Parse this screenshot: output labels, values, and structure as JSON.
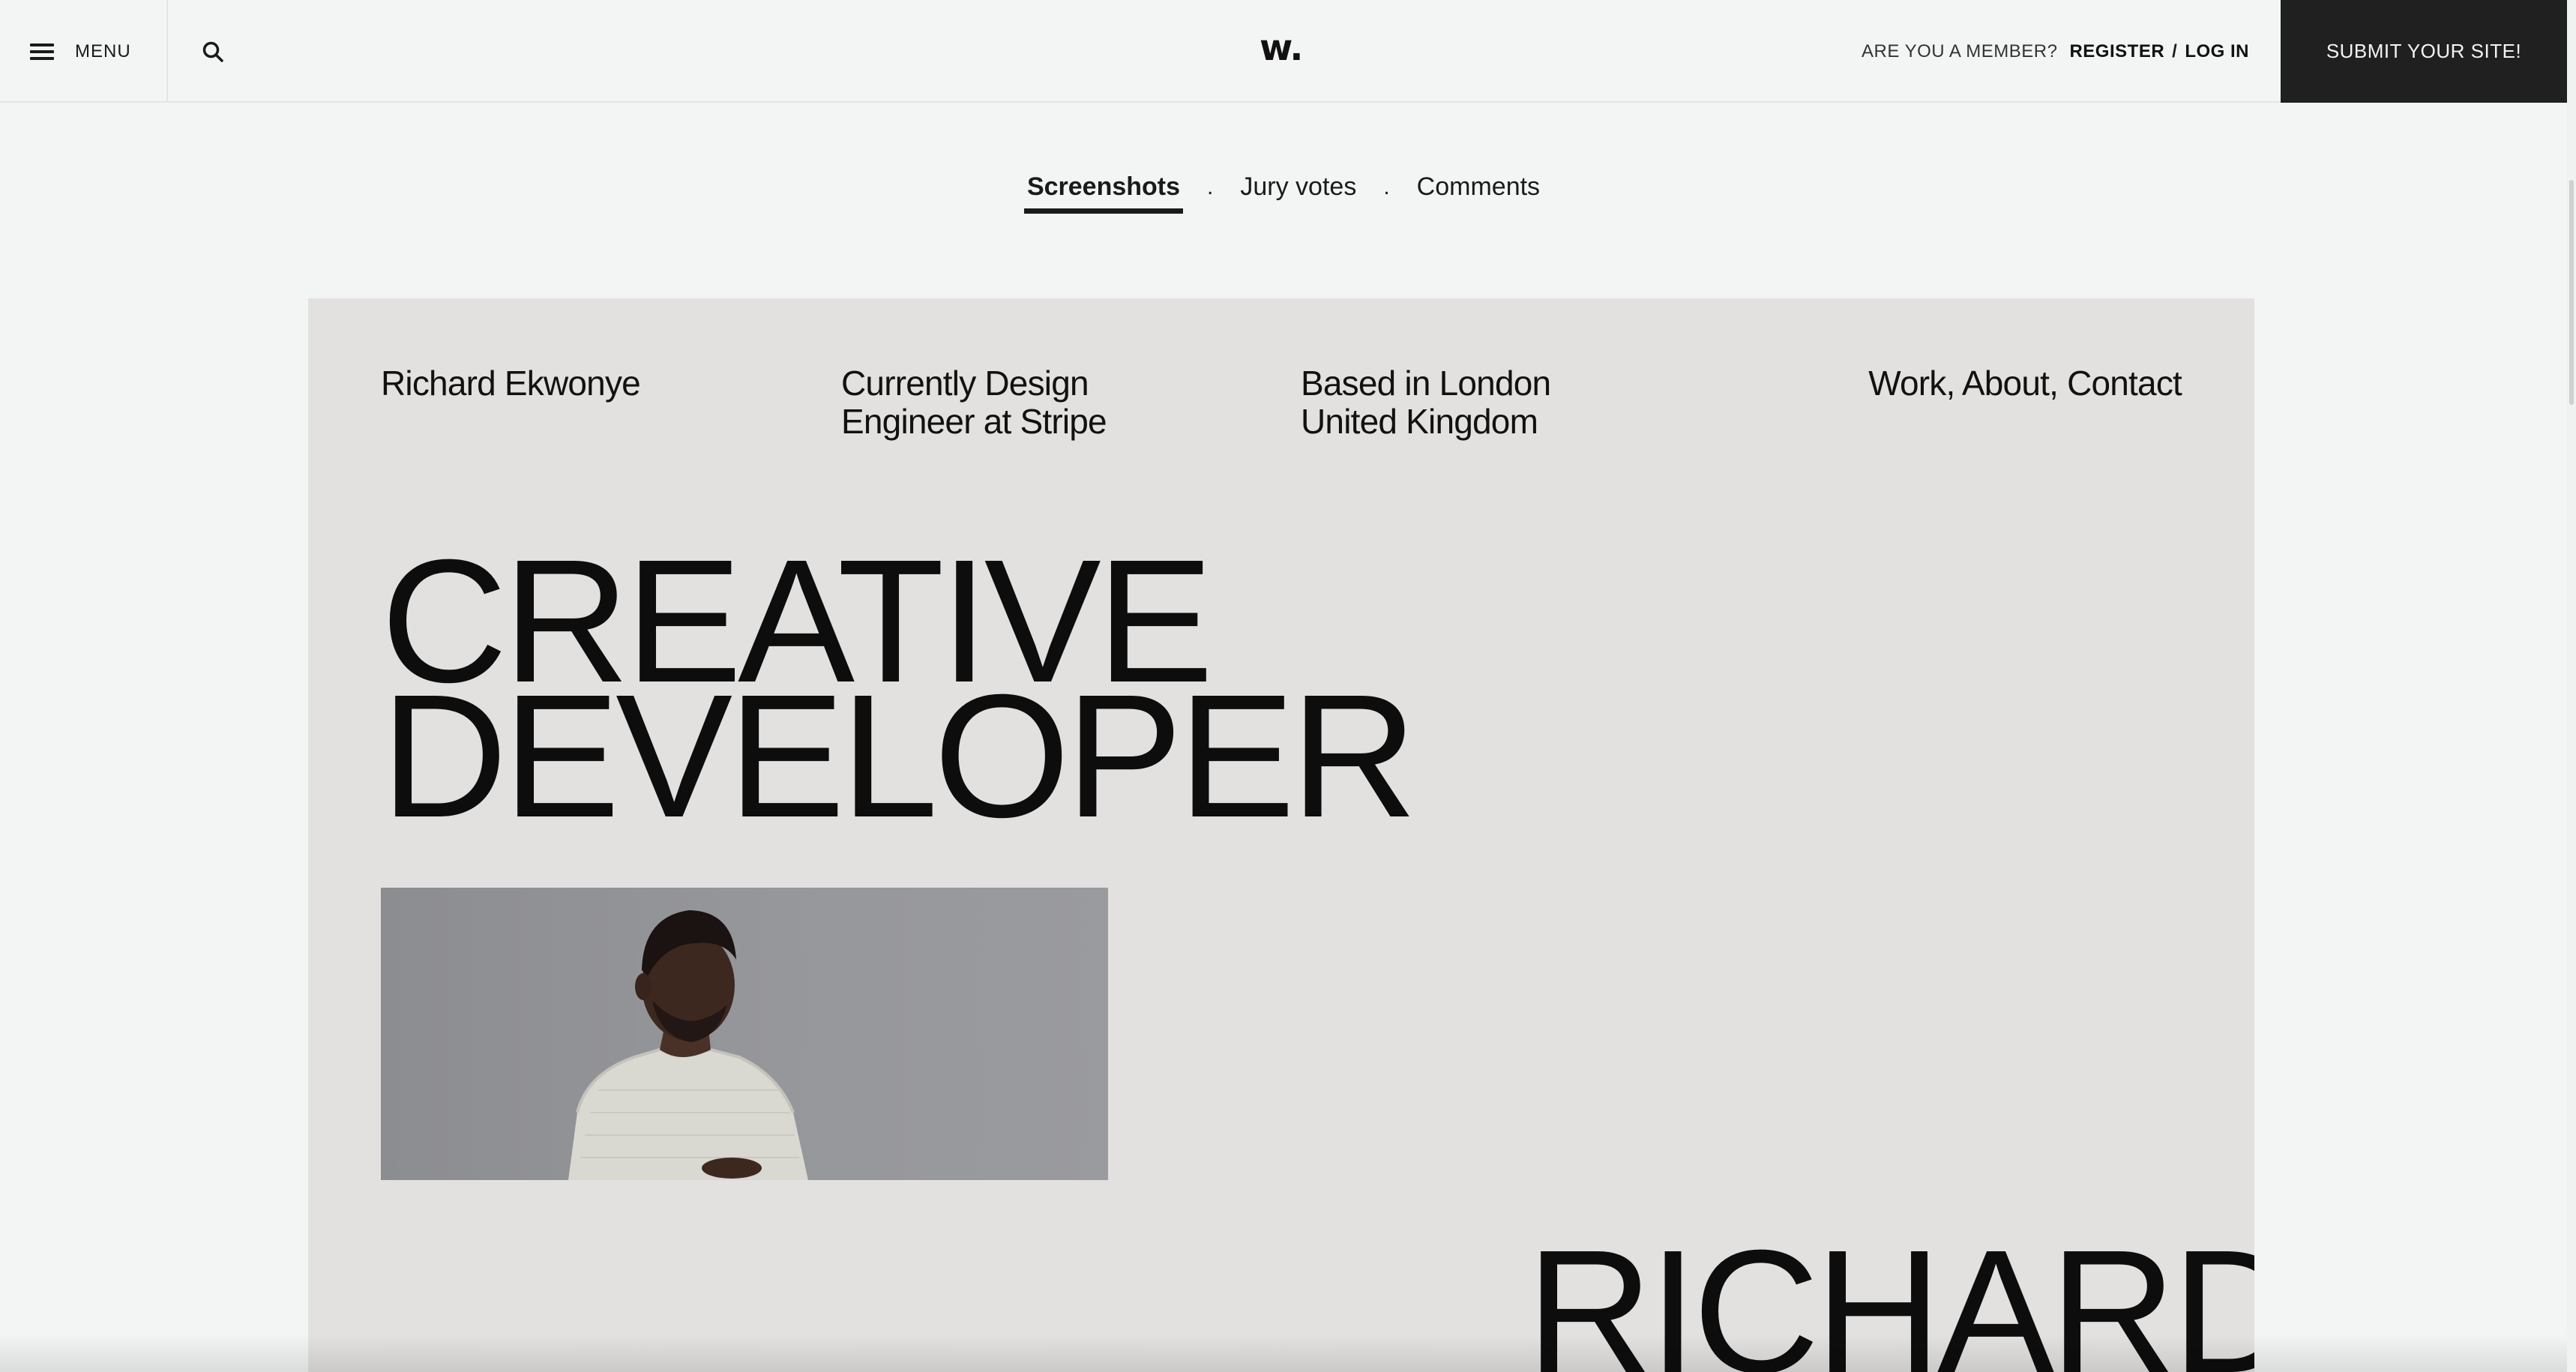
{
  "header": {
    "menu_label": "MENU",
    "logo": "w.",
    "member_question": "ARE YOU A MEMBER?",
    "register_label": "REGISTER",
    "separator": "/",
    "login_label": "LOG IN",
    "submit_label": "SUBMIT YOUR SITE!"
  },
  "tabs": {
    "items": [
      {
        "label": "Screenshots",
        "active": true
      },
      {
        "label": "Jury votes",
        "active": false
      },
      {
        "label": "Comments",
        "active": false
      }
    ],
    "dot": "."
  },
  "screenshot": {
    "name": "Richard Ekwonye",
    "role_line1": "Currently Design",
    "role_line2": "Engineer at Stripe",
    "location_line1": "Based in London",
    "location_line2": "United Kingdom",
    "nav": "Work, About, Contact",
    "title_line1": "CREATIVE",
    "title_line2": "DEVELOPER",
    "big_name": "RICHARD",
    "background_color": "#e2e1df"
  },
  "icons": {
    "menu": "hamburger-icon",
    "search": "search-icon"
  },
  "colors": {
    "page_bg": "#f3f5f4",
    "submit_bg": "#1f201f",
    "text": "#1a1a1a"
  }
}
